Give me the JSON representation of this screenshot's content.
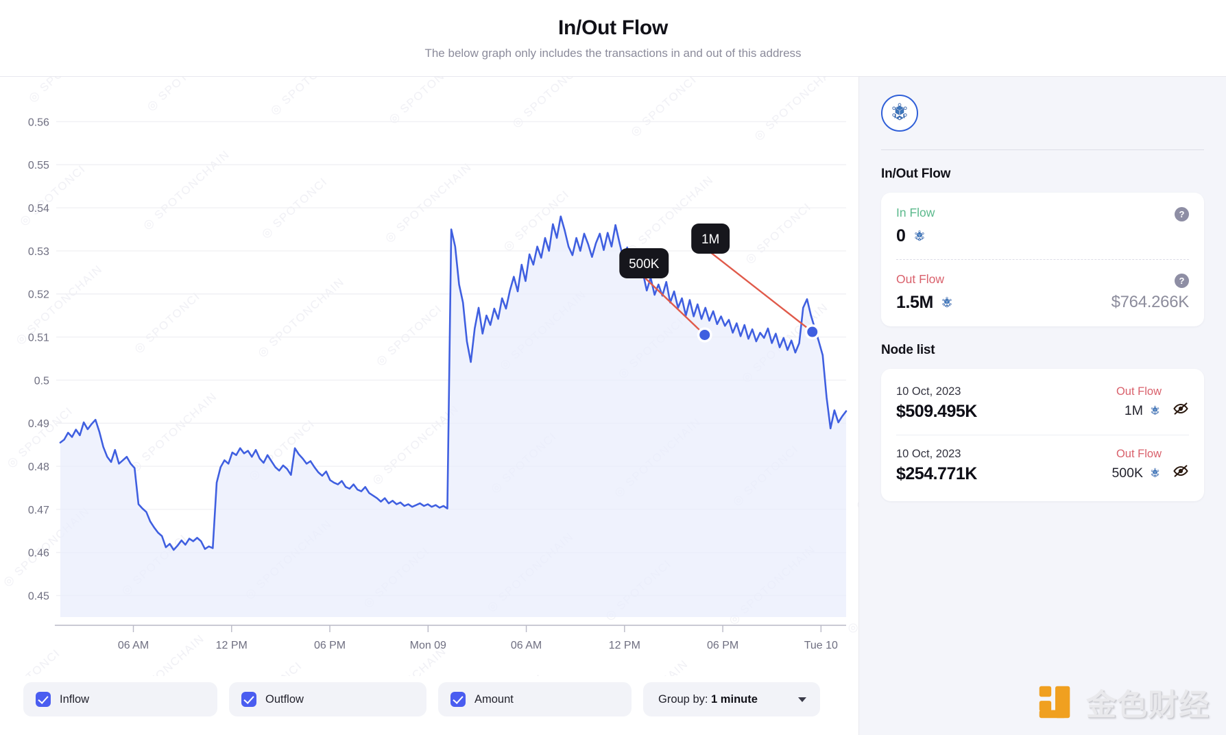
{
  "header": {
    "title": "In/Out Flow",
    "subtitle": "The below graph only includes the transactions in and out of this address"
  },
  "controls": {
    "inflow_label": "Inflow",
    "outflow_label": "Outflow",
    "amount_label": "Amount",
    "group_by_prefix": "Group by: ",
    "group_by_value": "1 minute"
  },
  "sidebar": {
    "network_icon": "network-node-icon",
    "section_flow_title": "In/Out Flow",
    "in_flow": {
      "label": "In Flow",
      "value": "0",
      "help": "?"
    },
    "out_flow": {
      "label": "Out Flow",
      "value": "1.5M",
      "usd": "$764.266K",
      "help": "?"
    },
    "node_list_title": "Node list",
    "nodes": [
      {
        "date": "10 Oct, 2023",
        "usd": "$509.495K",
        "flow_label": "Out Flow",
        "amount": "1M",
        "visibility_icon": "eye-off-icon"
      },
      {
        "date": "10 Oct, 2023",
        "usd": "$254.771K",
        "flow_label": "Out Flow",
        "amount": "500K",
        "visibility_icon": "eye-off-icon"
      }
    ]
  },
  "watermark": {
    "chart_text": "SPOTONCHAIN",
    "brand_text": "金色财经",
    "brand_color": "#f0a020"
  },
  "chart_data": {
    "type": "line",
    "title": "In/Out Flow",
    "xlabel": "",
    "ylabel": "",
    "ylim": [
      0.445,
      0.565
    ],
    "yticks": [
      0.45,
      0.46,
      0.47,
      0.48,
      0.49,
      0.5,
      0.51,
      0.52,
      0.53,
      0.54,
      0.55,
      0.56
    ],
    "ytick_labels": [
      "0.45",
      "0.46",
      "0.47",
      "0.48",
      "0.49",
      "0.5",
      "0.51",
      "0.52",
      "0.53",
      "0.54",
      "0.55",
      "0.56"
    ],
    "xticks_labels": [
      "06 AM",
      "12 PM",
      "06 PM",
      "Mon 09",
      "06 AM",
      "12 PM",
      "06 PM",
      "Tue 10"
    ],
    "xtick_positions": [
      0.093,
      0.218,
      0.343,
      0.468,
      0.593,
      0.718,
      0.843,
      0.968
    ],
    "grid": true,
    "legend": null,
    "line_color": "#3f5fe0",
    "area_fill": "#eaeefc",
    "series": [
      {
        "name": "Amount",
        "values": [
          0.4855,
          0.4862,
          0.4878,
          0.4868,
          0.4885,
          0.4872,
          0.4902,
          0.4886,
          0.4898,
          0.4908,
          0.488,
          0.4845,
          0.4822,
          0.481,
          0.4838,
          0.4806,
          0.4814,
          0.4822,
          0.4806,
          0.4796,
          0.4712,
          0.4702,
          0.4694,
          0.4672,
          0.4658,
          0.4646,
          0.4638,
          0.4612,
          0.462,
          0.4606,
          0.4616,
          0.4628,
          0.4618,
          0.4632,
          0.4626,
          0.4634,
          0.4626,
          0.4608,
          0.4614,
          0.461,
          0.4762,
          0.4798,
          0.4814,
          0.4806,
          0.4832,
          0.4826,
          0.4842,
          0.483,
          0.4836,
          0.4822,
          0.4838,
          0.4818,
          0.4808,
          0.4826,
          0.4812,
          0.4798,
          0.479,
          0.4802,
          0.4794,
          0.478,
          0.4842,
          0.4828,
          0.4818,
          0.4806,
          0.4812,
          0.4798,
          0.4786,
          0.4778,
          0.4788,
          0.4768,
          0.4762,
          0.4758,
          0.4766,
          0.4752,
          0.4748,
          0.4758,
          0.4746,
          0.4742,
          0.4752,
          0.4738,
          0.4732,
          0.4726,
          0.4718,
          0.4726,
          0.4714,
          0.472,
          0.4712,
          0.4716,
          0.4708,
          0.4712,
          0.4706,
          0.471,
          0.4714,
          0.4708,
          0.4712,
          0.4706,
          0.471,
          0.4704,
          0.4708,
          0.4702,
          0.535,
          0.531,
          0.5222,
          0.518,
          0.509,
          0.5042,
          0.512,
          0.5168,
          0.5108,
          0.515,
          0.5128,
          0.5166,
          0.5142,
          0.519,
          0.5166,
          0.5208,
          0.524,
          0.5206,
          0.5268,
          0.523,
          0.5292,
          0.5268,
          0.531,
          0.5284,
          0.533,
          0.53,
          0.5362,
          0.533,
          0.538,
          0.5348,
          0.531,
          0.529,
          0.533,
          0.53,
          0.534,
          0.5316,
          0.5286,
          0.5318,
          0.534,
          0.5302,
          0.5342,
          0.531,
          0.536,
          0.532,
          0.5282,
          0.5308,
          0.5262,
          0.524,
          0.5282,
          0.525,
          0.5208,
          0.5238,
          0.5198,
          0.5222,
          0.5196,
          0.5228,
          0.518,
          0.5206,
          0.5168,
          0.519,
          0.515,
          0.5186,
          0.5148,
          0.5176,
          0.5142,
          0.5168,
          0.5138,
          0.516,
          0.513,
          0.5148,
          0.5126,
          0.514,
          0.511,
          0.5132,
          0.5102,
          0.5128,
          0.5096,
          0.5118,
          0.509,
          0.511,
          0.5098,
          0.512,
          0.5086,
          0.5108,
          0.5076,
          0.5098,
          0.507,
          0.5092,
          0.5064,
          0.5086,
          0.5168,
          0.5188,
          0.515,
          0.512,
          0.509,
          0.5058,
          0.496,
          0.4888,
          0.493,
          0.4902,
          0.4916,
          0.4928
        ]
      }
    ],
    "annotations": [
      {
        "label": "500K",
        "x_fraction": 0.82,
        "y_value": 0.5105,
        "marker_color": "#3f5fe0",
        "connector_color": "#e05a4a",
        "badge_bg": "#16161c",
        "badge_text_color": "#ffffff"
      },
      {
        "label": "1M",
        "x_fraction": 0.957,
        "y_value": 0.5112,
        "marker_color": "#3f5fe0",
        "connector_color": "#e05a4a",
        "badge_bg": "#16161c",
        "badge_text_color": "#ffffff"
      }
    ]
  }
}
